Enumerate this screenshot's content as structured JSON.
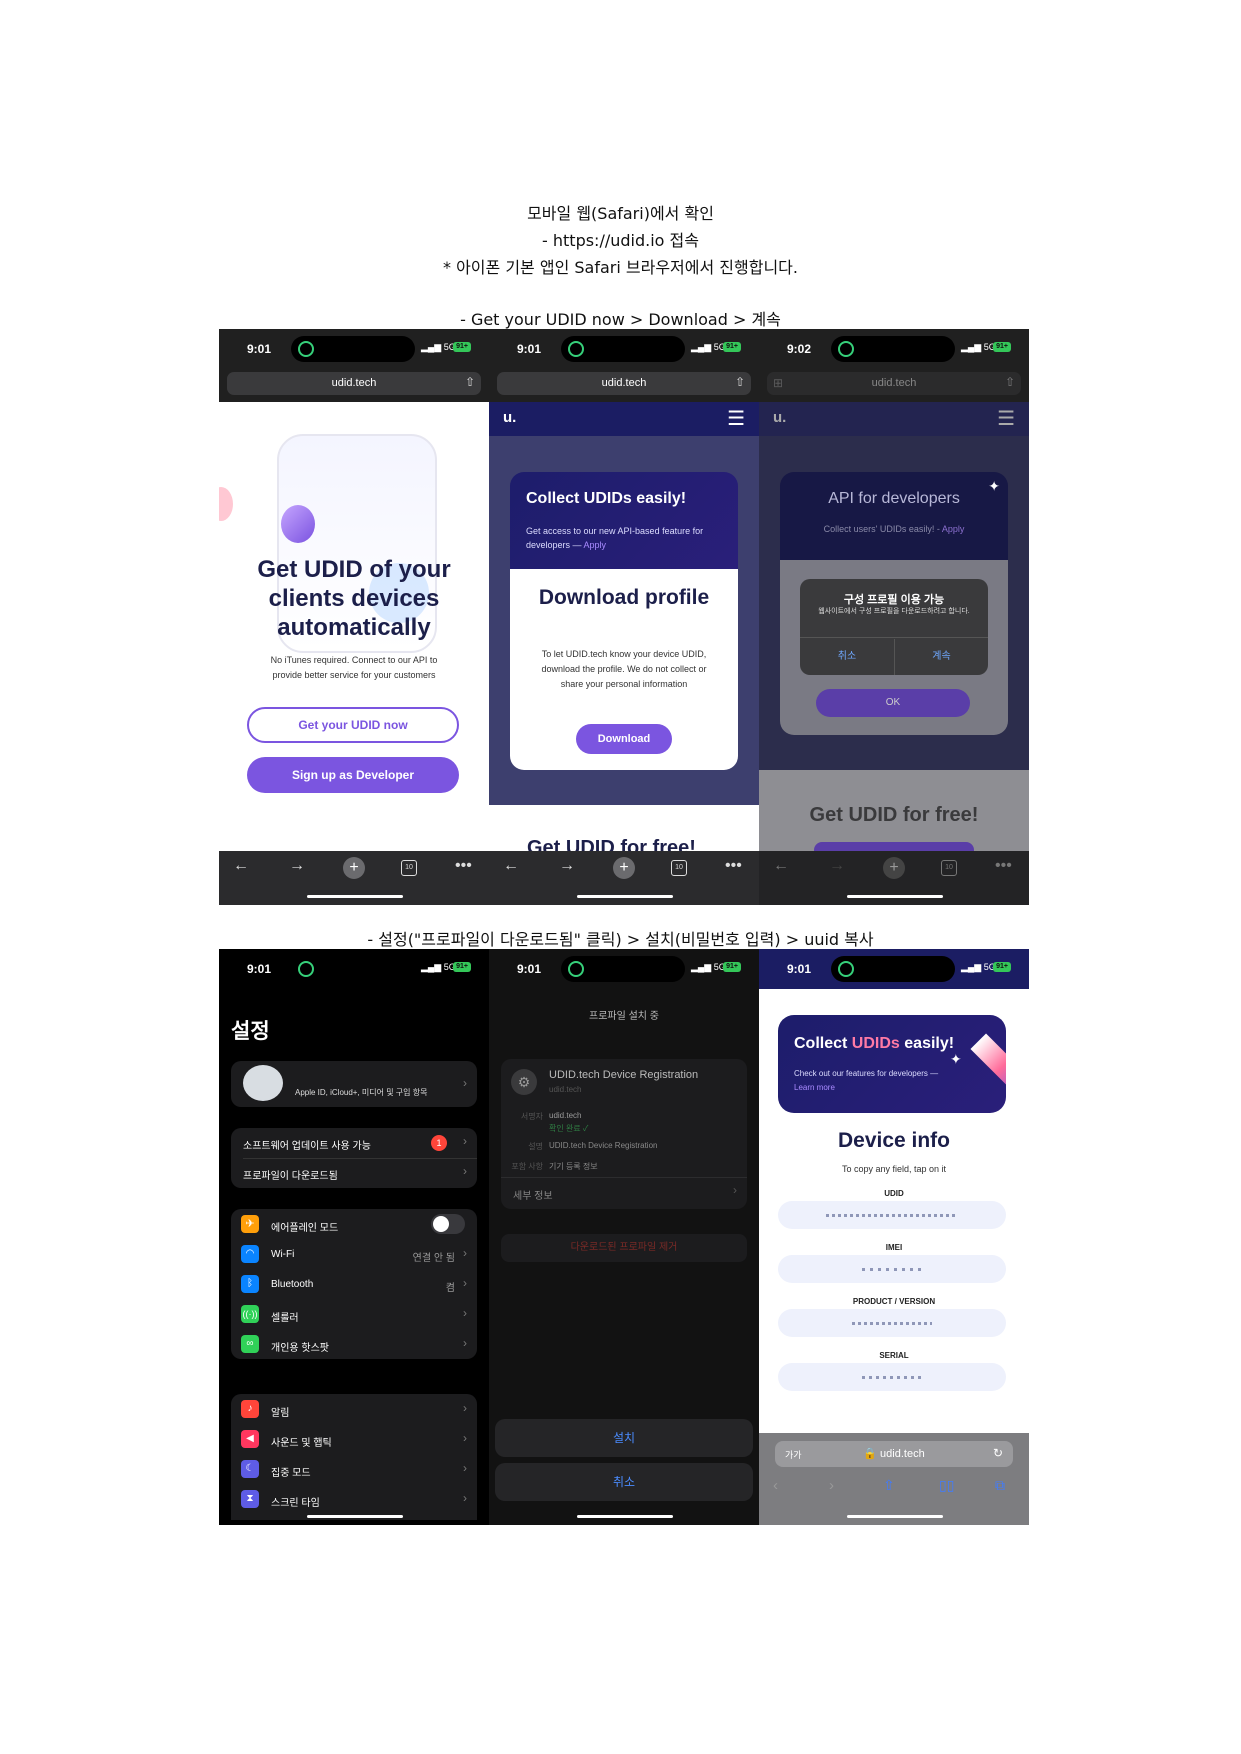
{
  "intro": {
    "line1": "모바일 웹(Safari)에서 확인",
    "line2": "- https://udid.io 접속",
    "line3": "* 아이폰 기본 앱인 Safari 브라우저에서 진행합니다."
  },
  "step1": {
    "caption": "- Get your UDID now > Download > 계속",
    "status": {
      "time_a": "9:01",
      "time_b": "9:01",
      "time_c": "9:02",
      "signal": "5G",
      "battery": "91+"
    },
    "url": "udid.tech",
    "tabs_count": "10",
    "screen1": {
      "headline": "Get UDID of your clients devices automatically",
      "subtext": "No iTunes required. Connect to our API to provide better service for your customers",
      "btn_primary": "Get your UDID now",
      "btn_secondary": "Sign up as Developer"
    },
    "screen2": {
      "logo": "u.",
      "banner_title": "Collect UDIDs easily!",
      "banner_sub": "Get access to our new API-based feature for developers —",
      "banner_link": "Apply",
      "card_title": "Download profile",
      "card_text": "To let UDID.tech know your device UDID, download the profile. We do not collect or share your personal information",
      "card_button": "Download",
      "bottom_peek": "Get UDID for free!"
    },
    "screen3": {
      "logo": "u.",
      "banner_title": "API for developers",
      "banner_sub": "Collect users' UDIDs easily! -",
      "banner_link": "Apply",
      "dialog_title": "구성 프로필 이용 가능",
      "dialog_text": "웹사이트에서 구성 프로필을 다운로드하려고 합니다.",
      "dialog_cancel": "취소",
      "dialog_continue": "계속",
      "ok": "OK",
      "bottom_title": "Get UDID for free!"
    }
  },
  "step2": {
    "caption": "- 설정(\"프로파일이 다운로드됨\" 클릭) > 설치(비밀번호 입력) > uuid 복사",
    "status": {
      "time_a": "9:01",
      "time_b": "9:01",
      "time_c": "9:01"
    },
    "settings": {
      "title": "설정",
      "account_sub": "Apple ID, iCloud+, 미디어 및 구입 항목",
      "update": "소프트웨어 업데이트 사용 가능",
      "update_badge": "1",
      "profile": "프로파일이 다운로드됨",
      "airplane": "에어플레인 모드",
      "wifi": "Wi-Fi",
      "wifi_value": "연결 안 됨",
      "bluetooth": "Bluetooth",
      "bluetooth_value": "켬",
      "cellular": "셀룰러",
      "hotspot": "개인용 핫스팟",
      "notifications": "알림",
      "sound": "사운드 및 햅틱",
      "focus": "집중 모드",
      "screentime": "스크린 타임"
    },
    "install": {
      "header": "프로파일 설치 중",
      "profile_name": "UDID.tech Device Registration",
      "profile_domain": "udid.tech",
      "signed_label": "서명자",
      "signed_value": "udid.tech",
      "verified": "확인 완료 ✓",
      "desc_label": "설명",
      "desc_value": "UDID.tech Device Registration",
      "contains_label": "포함 사항",
      "contains_value": "기기 등록 정보",
      "more": "세부 정보",
      "remove": "다운로드된 프로파일 제거",
      "install_btn": "설치",
      "cancel_btn": "취소"
    },
    "info": {
      "banner_title_a": "Collect",
      "banner_title_b": "UDIDs",
      "banner_title_c": "easily!",
      "banner_sub": "Check out our features for developers —",
      "banner_link": "Learn more",
      "title": "Device info",
      "hint": "To copy any field, tap on it",
      "f1": "UDID",
      "f2": "IMEI",
      "f3": "PRODUCT / VERSION",
      "f4": "SERIAL",
      "bar_left": "가가",
      "bar_url": "🔒 udid.tech"
    }
  },
  "colors": {
    "brand": "#7b55e0",
    "navy": "#1b1d63",
    "dark": "#000000",
    "status": "#202020"
  }
}
